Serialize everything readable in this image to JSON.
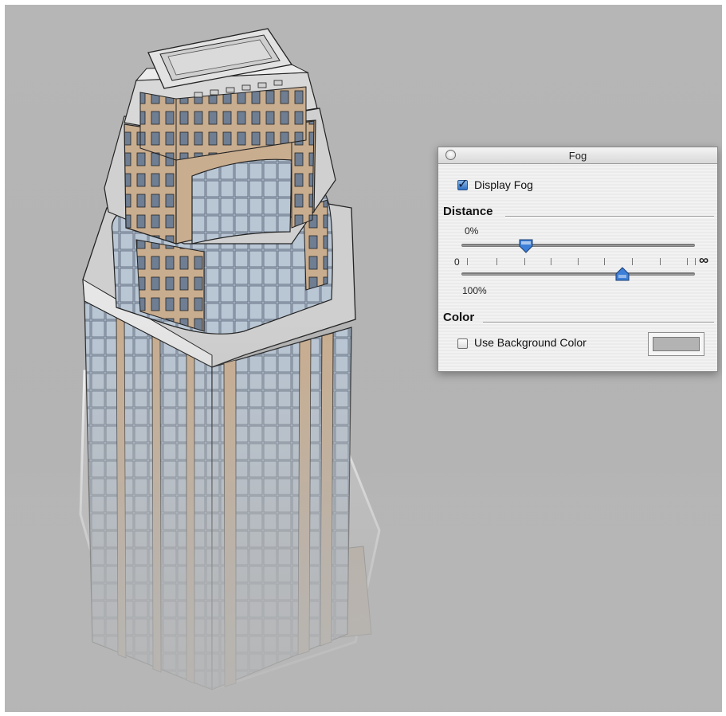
{
  "panel": {
    "title": "Fog",
    "display_fog": {
      "label": "Display Fog",
      "checked": true
    },
    "distance": {
      "title": "Distance",
      "start_label": "0%",
      "end_label": "100%",
      "scale_min_label": "0",
      "scale_max_label": "∞",
      "start_value_fraction": 0.27,
      "end_value_fraction": 0.69
    },
    "color": {
      "title": "Color",
      "use_background": {
        "label": "Use Background Color",
        "checked": false
      },
      "swatch_color": "#b3b3b3"
    }
  },
  "icons": {
    "close": "close-circle-icon",
    "check": "checkmark-icon",
    "slider_thumb_down": "slider-thumb-down-icon",
    "slider_thumb_up": "slider-thumb-up-icon"
  },
  "colors": {
    "viewport_background": "#b5b5b5",
    "building_stone": "#c9ad8f",
    "building_glass": "#9fb1c6",
    "building_roof": "#d2d2d2",
    "thumb_blue": "#3c7fd8"
  }
}
